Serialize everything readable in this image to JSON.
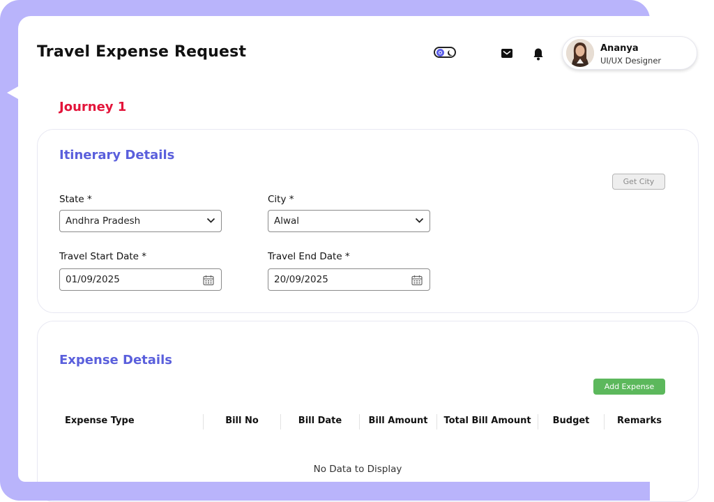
{
  "header": {
    "title": "Travel Expense Request",
    "user": {
      "name": "Ananya",
      "role": "UI/UX Designer"
    },
    "icons": [
      "theme-toggle-icon",
      "mail-icon",
      "bell-icon"
    ]
  },
  "journey": {
    "title": "Journey 1"
  },
  "itinerary": {
    "title": "Itinerary Details",
    "get_city_label": "Get City",
    "state": {
      "label": "State *",
      "value": "Andhra Pradesh"
    },
    "city": {
      "label": "City *",
      "value": "Alwal"
    },
    "start_date": {
      "label": "Travel Start Date *",
      "value": "01/09/2025"
    },
    "end_date": {
      "label": "Travel End Date *",
      "value": "20/09/2025"
    }
  },
  "expense": {
    "title": "Expense Details",
    "add_label": "Add Expense",
    "columns": [
      "Expense Type",
      "Bill No",
      "Bill Date",
      "Bill Amount",
      "Total Bill Amount",
      "Budget",
      "Remarks"
    ],
    "empty_message": "No Data to Display"
  },
  "colors": {
    "accent": "#5a5fdc",
    "journey": "#e3143a",
    "add_button": "#5cb85c",
    "frame": "#b9b4fb"
  }
}
